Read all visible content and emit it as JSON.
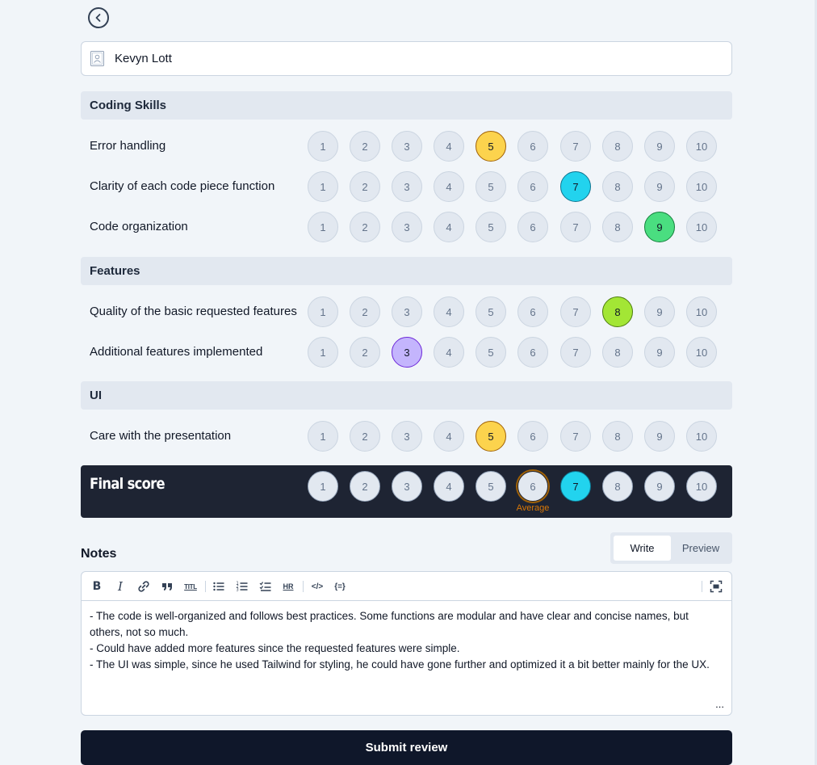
{
  "candidate": {
    "name": "Kevyn Lott"
  },
  "sections": [
    {
      "title": "Coding Skills",
      "criteria": [
        {
          "label": "Error handling",
          "selected": 5,
          "color": "#fcd34d"
        },
        {
          "label": "Clarity of each code piece function",
          "selected": 7,
          "color": "#22d3ee"
        },
        {
          "label": "Code organization",
          "selected": 9,
          "color": "#4ade80"
        }
      ]
    },
    {
      "title": "Features",
      "criteria": [
        {
          "label": "Quality of the basic requested features",
          "selected": 8,
          "color": "#a3e635"
        },
        {
          "label": "Additional features implemented",
          "selected": 3,
          "color": "#c4b5fd"
        }
      ]
    },
    {
      "title": "UI",
      "criteria": [
        {
          "label": "Care with the presentation",
          "selected": 5,
          "color": "#fcd34d"
        }
      ]
    }
  ],
  "scale": [
    "1",
    "2",
    "3",
    "4",
    "5",
    "6",
    "7",
    "8",
    "9",
    "10"
  ],
  "final_score": {
    "title": "Final score",
    "selected": 7,
    "average": 6,
    "average_label": "Average",
    "selected_color": "#22d3ee"
  },
  "notes": {
    "label": "Notes",
    "tabs": {
      "write": "Write",
      "preview": "Preview",
      "active": "Write"
    },
    "toolbar": {
      "bold": "B",
      "italic": "I",
      "link": "link-icon",
      "quote": "quote-icon",
      "title": "TITL",
      "unordered_list": "unordered-list-icon",
      "ordered_list": "ordered-list-icon",
      "checklist": "checklist-icon",
      "hr": "HR",
      "code": "</>",
      "code_block": "{=}",
      "fullscreen": "fullscreen-icon"
    },
    "lines": [
      "- The code is well-organized and follows best practices. Some functions are modular and have clear and concise names, but others, not so much.",
      "- Could have added more features since the requested features were simple.",
      "- The UI was simple, since he used Tailwind for styling, he could have gone further and optimized it a bit better mainly for the UX."
    ],
    "resize_handle": "..."
  },
  "submit": {
    "label": "Submit review"
  }
}
